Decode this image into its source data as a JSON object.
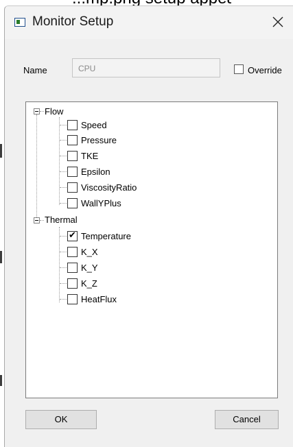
{
  "window": {
    "title": "Monitor Setup"
  },
  "top_fragment": "...mp.png setup appears",
  "form": {
    "name_label": "Name",
    "name_value": "CPU",
    "override_label": "Override",
    "override_checked": false
  },
  "tree": {
    "groups": [
      {
        "label": "Flow",
        "expanded": true,
        "items": [
          {
            "label": "Speed",
            "checked": false
          },
          {
            "label": "Pressure",
            "checked": false
          },
          {
            "label": "TKE",
            "checked": false
          },
          {
            "label": "Epsilon",
            "checked": false
          },
          {
            "label": "ViscosityRatio",
            "checked": false
          },
          {
            "label": "WallYPlus",
            "checked": false
          }
        ]
      },
      {
        "label": "Thermal",
        "expanded": true,
        "items": [
          {
            "label": "Temperature",
            "checked": true
          },
          {
            "label": "K_X",
            "checked": false
          },
          {
            "label": "K_Y",
            "checked": false
          },
          {
            "label": "K_Z",
            "checked": false
          },
          {
            "label": "HeatFlux",
            "checked": false
          }
        ]
      }
    ]
  },
  "buttons": {
    "ok_label": "OK",
    "cancel_label": "Cancel"
  }
}
